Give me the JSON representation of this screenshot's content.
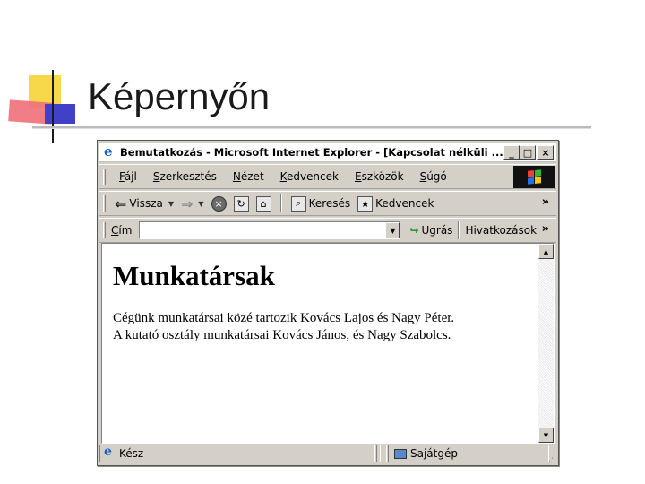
{
  "slide": {
    "title": "Képernyőn"
  },
  "window": {
    "title": "Bemutatkozás - Microsoft Internet Explorer - [Kapcsolat nélküli ...",
    "buttons": {
      "minimize": "_",
      "maximize": "□",
      "close": "×"
    }
  },
  "menu": {
    "items": [
      {
        "accel": "F",
        "rest": "ájl"
      },
      {
        "accel": "S",
        "rest": "zerkesztés"
      },
      {
        "accel": "N",
        "rest": "ézet"
      },
      {
        "accel": "K",
        "rest": "edvencek"
      },
      {
        "accel": "E",
        "rest": "szközök"
      },
      {
        "accel": "S",
        "rest": "úgó"
      }
    ]
  },
  "toolbar": {
    "back": "Vissza",
    "search": "Keresés",
    "favorites": "Kedvencek",
    "more": "»"
  },
  "address": {
    "label_accel": "C",
    "label_rest": "ím",
    "value": "",
    "go": "Ugrás",
    "links": "Hivatkozások",
    "more": "»"
  },
  "page": {
    "heading": "Munkatársak",
    "lines": [
      "Cégünk munkatársai közé tartozik Kovács Lajos és Nagy Péter.",
      "A kutató osztály munkatársai Kovács János, és Nagy Szabolcs."
    ]
  },
  "status": {
    "text": "Kész",
    "zone": "Sajátgép"
  },
  "colors": {
    "window_chrome": "#d4d0c8",
    "ie_blue": "#1a5fc4",
    "deco_yellow": "#f6d84a",
    "deco_red": "#f0707a",
    "deco_blue": "#4040c8"
  },
  "icons": [
    "ie-logo-icon",
    "windows-flag-icon",
    "back-arrow-icon",
    "forward-arrow-icon",
    "stop-icon",
    "refresh-icon",
    "home-icon",
    "search-icon",
    "favorites-icon",
    "go-arrow-icon",
    "computer-icon"
  ]
}
